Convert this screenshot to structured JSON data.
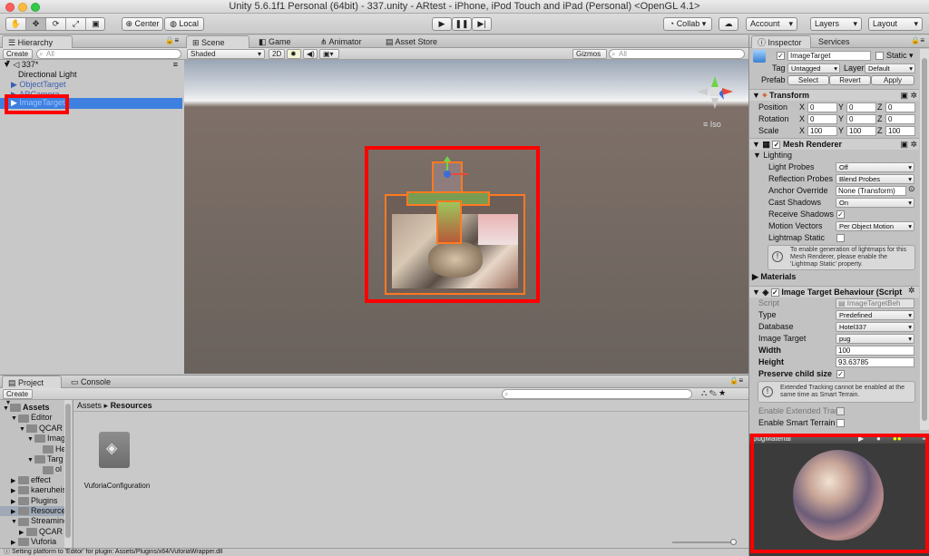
{
  "window": {
    "title": "Unity 5.6.1f1 Personal (64bit) - 337.unity - ARtest - iPhone, iPod Touch and iPad (Personal) <OpenGL 4.1>"
  },
  "toolbar": {
    "pivot_label": "Center",
    "space_label": "Local",
    "collab_label": "Collab",
    "account_label": "Account",
    "layers_label": "Layers",
    "layout_label": "Layout"
  },
  "hierarchy": {
    "tab": "Hierarchy",
    "create": "Create",
    "search_placeholder": "All",
    "scene": "337*",
    "items": [
      "Directional Light",
      "ObjectTarget",
      "ARCamera",
      "ImageTarget"
    ]
  },
  "scene_view": {
    "tabs": [
      "Scene",
      "Game",
      "Animator",
      "Asset Store"
    ],
    "shading": "Shaded",
    "mode_2d": "2D",
    "gizmos": "Gizmos",
    "search_placeholder": "All",
    "iso": "Iso"
  },
  "inspector": {
    "tabs": [
      "Inspector",
      "Services"
    ],
    "object_name": "ImageTarget",
    "static_label": "Static",
    "tag_label": "Tag",
    "tag_value": "Untagged",
    "layer_label": "Layer",
    "layer_value": "Default",
    "prefab_label": "Prefab",
    "prefab_buttons": [
      "Select",
      "Revert",
      "Apply"
    ],
    "transform": {
      "title": "Transform",
      "rows": [
        {
          "label": "Position",
          "x": "0",
          "y": "0",
          "z": "0"
        },
        {
          "label": "Rotation",
          "x": "0",
          "y": "0",
          "z": "0"
        },
        {
          "label": "Scale",
          "x": "100",
          "y": "100",
          "z": "100"
        }
      ],
      "axis_labels": [
        "X",
        "Y",
        "Z"
      ]
    },
    "mesh_renderer": {
      "title": "Mesh Renderer",
      "lighting": "Lighting",
      "light_probes_label": "Light Probes",
      "light_probes_value": "Off",
      "reflection_probes_label": "Reflection Probes",
      "reflection_probes_value": "Blend Probes",
      "anchor_override_label": "Anchor Override",
      "anchor_override_value": "None (Transform)",
      "cast_shadows_label": "Cast Shadows",
      "cast_shadows_value": "On",
      "receive_shadows_label": "Receive Shadows",
      "motion_vectors_label": "Motion Vectors",
      "motion_vectors_value": "Per Object Motion",
      "lightmap_static_label": "Lightmap Static",
      "info": "To enable generation of lightmaps for this Mesh Renderer, please enable the 'Lightmap Static' property."
    },
    "materials_label": "Materials",
    "image_target_behaviour": {
      "title": "Image Target Behaviour (Script",
      "script_label": "Script",
      "script_value": "ImageTargetBeh",
      "type_label": "Type",
      "type_value": "Predefined",
      "database_label": "Database",
      "database_value": "Hotel337",
      "image_target_label": "Image Target",
      "image_target_value": "pug",
      "width_label": "Width",
      "width_value": "100",
      "height_label": "Height",
      "height_value": "93.63785",
      "preserve_child_label": "Preserve child size",
      "info": "Extended Tracking cannot be enabled at the same time as Smart Terrain.",
      "extended_tracking_label": "Enable Extended Tracki",
      "smart_terrain_label": "Enable Smart Terrain"
    },
    "preview_title": "pugMaterial"
  },
  "project": {
    "tabs": [
      "Project",
      "Console"
    ],
    "create": "Create",
    "breadcrumb": [
      "Assets",
      "Resources"
    ],
    "tree": [
      {
        "label": "Assets",
        "indent": 0
      },
      {
        "label": "Editor",
        "indent": 1
      },
      {
        "label": "QCAR",
        "indent": 2
      },
      {
        "label": "Imag",
        "indent": 3
      },
      {
        "label": "He",
        "indent": 4
      },
      {
        "label": "Targ",
        "indent": 3
      },
      {
        "label": "ol",
        "indent": 4
      },
      {
        "label": "effect",
        "indent": 1
      },
      {
        "label": "kaeruheis",
        "indent": 1
      },
      {
        "label": "Plugins",
        "indent": 1
      },
      {
        "label": "Resources",
        "indent": 1
      },
      {
        "label": "Streaming",
        "indent": 1
      },
      {
        "label": "QCAR",
        "indent": 2
      },
      {
        "label": "Vuforia",
        "indent": 1
      }
    ],
    "asset_name": "VuforiaConfiguration"
  },
  "status_bar": {
    "text": "Setting platform to 'Editor' for plugin: Assets/Plugins/x64/VuforiaWrapper.dll"
  }
}
